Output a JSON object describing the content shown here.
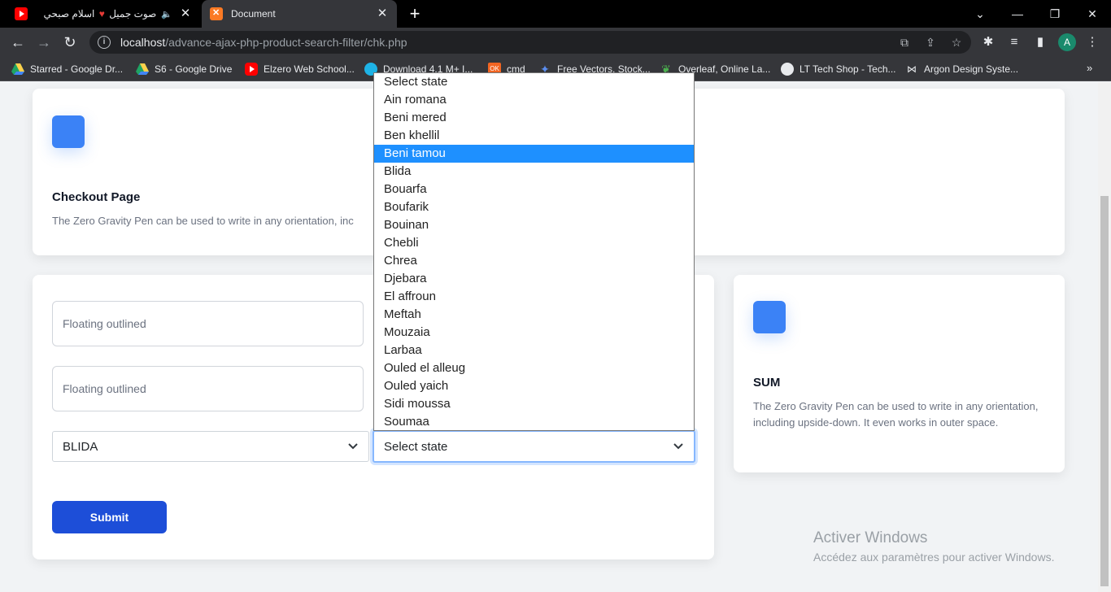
{
  "browser": {
    "tabs": [
      {
        "title": "اسلام صبحي",
        "title_suffix": "صوت جميل",
        "active": false
      },
      {
        "title": "Document",
        "active": true
      }
    ],
    "url_host": "localhost",
    "url_path": "/advance-ajax-php-product-search-filter/chk.php",
    "bookmarks": [
      {
        "label": "Starred - Google Dr...",
        "icon": "google-drive-icon"
      },
      {
        "label": "S6 - Google Drive",
        "icon": "google-drive-icon"
      },
      {
        "label": "Elzero Web School...",
        "icon": "youtube-icon"
      },
      {
        "label": "Download 4.1 M+ I...",
        "icon": "freepik-icon"
      },
      {
        "label": "cmd",
        "icon": "ok-icon"
      },
      {
        "label": "Free Vectors, Stock...",
        "icon": "vecteezy-icon"
      },
      {
        "label": "Overleaf, Online La...",
        "icon": "overleaf-icon"
      },
      {
        "label": "LT Tech Shop - Tech...",
        "icon": "globe-icon"
      },
      {
        "label": "Argon Design Syste...",
        "icon": "argon-icon"
      }
    ],
    "avatar_letter": "A"
  },
  "header_card": {
    "title": "Checkout Page",
    "text": "The Zero Gravity Pen can be used to write in any orientation, inc"
  },
  "form": {
    "input1_placeholder": "Floating outlined",
    "input2_placeholder": "Floating outlined",
    "wilaya_value": "BLIDA",
    "state_value": "Select state",
    "submit_label": "Submit"
  },
  "sum_card": {
    "title": "SUM",
    "text": "The Zero Gravity Pen can be used to write in any orientation, including upside-down. It even works in outer space."
  },
  "dropdown": {
    "options": [
      "Select state",
      "Ain romana",
      "Beni mered",
      "Ben khellil",
      "Beni tamou",
      "Blida",
      "Bouarfa",
      "Boufarik",
      "Bouinan",
      "Chebli",
      "Chrea",
      "Djebara",
      "El affroun",
      "Meftah",
      "Mouzaia",
      "Larbaa",
      "Ouled el alleug",
      "Ouled yaich",
      "Sidi moussa",
      "Soumaa"
    ],
    "highlighted": "Beni tamou"
  },
  "watermark": {
    "title": "Activer Windows",
    "subtitle": "Accédez aux paramètres pour activer Windows."
  },
  "colors": {
    "accent": "#3b82f6",
    "submit": "#1d4ed8",
    "highlight": "#1e90ff"
  }
}
